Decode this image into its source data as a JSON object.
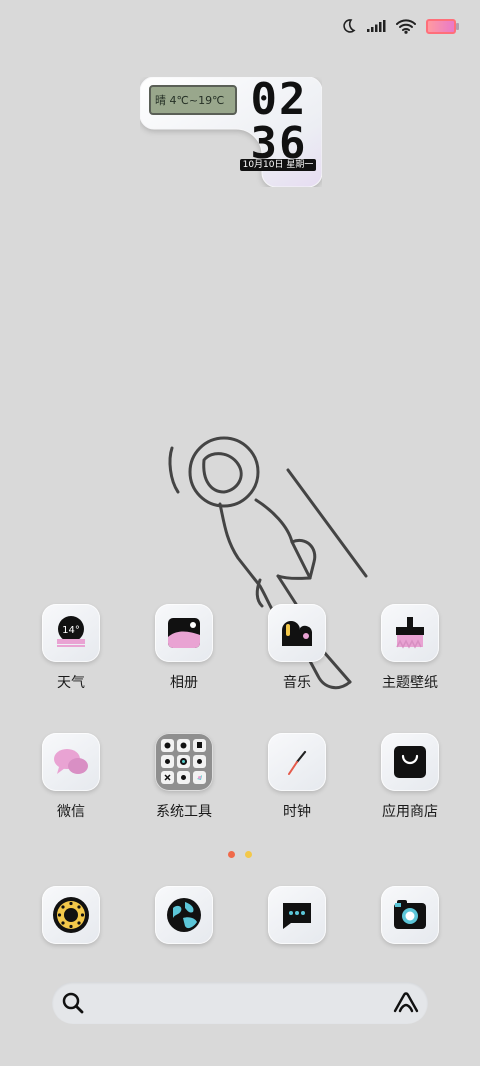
{
  "status_bar": {
    "icons": [
      "moon-icon",
      "signal-icon",
      "wifi-icon",
      "battery-icon"
    ],
    "battery_colors": [
      "#ff9aa0",
      "#e979c9"
    ]
  },
  "clock_widget": {
    "weather_text": "晴 4℃~19℃",
    "hour": "02",
    "minute": "36",
    "date": "10月10日 星期一"
  },
  "apps_row1": [
    {
      "label": "天气",
      "icon": "weather-icon",
      "badge": "14°"
    },
    {
      "label": "相册",
      "icon": "gallery-icon"
    },
    {
      "label": "音乐",
      "icon": "music-icon"
    },
    {
      "label": "主题壁纸",
      "icon": "theme-brush-icon"
    }
  ],
  "apps_row2": [
    {
      "label": "微信",
      "icon": "wechat-icon"
    },
    {
      "label": "系统工具",
      "icon": "folder-icon"
    },
    {
      "label": "时钟",
      "icon": "clock-icon"
    },
    {
      "label": "应用商店",
      "icon": "app-store-icon"
    }
  ],
  "dock": [
    {
      "icon": "phone-dial-icon"
    },
    {
      "icon": "browser-globe-icon"
    },
    {
      "icon": "messages-icon"
    },
    {
      "icon": "camera-icon"
    }
  ],
  "page_indicator": {
    "count": 2,
    "active": 0,
    "colors": [
      "#f06a4a",
      "#f3c84a"
    ]
  },
  "search": {
    "left_icon": "search-icon",
    "right_icon": "assistant-icon"
  },
  "accent": "#e9a3d3"
}
